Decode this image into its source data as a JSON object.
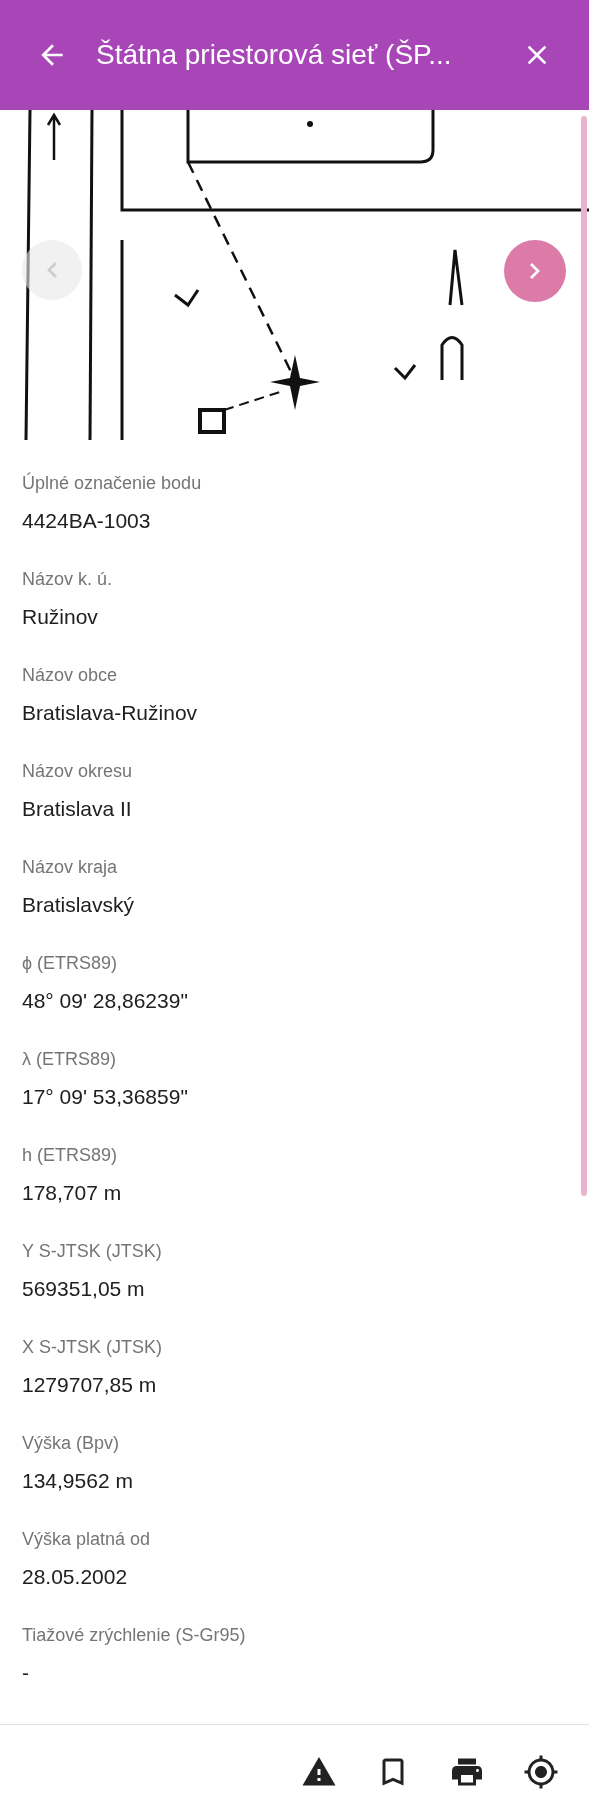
{
  "header": {
    "title": "Štátna priestorová sieť (ŠP..."
  },
  "gallery": {
    "prev_disabled": true
  },
  "fields": [
    {
      "label": "Úplné označenie bodu",
      "value": "4424BA-1003"
    },
    {
      "label": "Názov k. ú.",
      "value": "Ružinov"
    },
    {
      "label": "Názov obce",
      "value": "Bratislava-Ružinov"
    },
    {
      "label": "Názov okresu",
      "value": "Bratislava II"
    },
    {
      "label": "Názov kraja",
      "value": "Bratislavský"
    },
    {
      "label": "ϕ (ETRS89)",
      "value": "48° 09' 28,86239\""
    },
    {
      "label": "λ (ETRS89)",
      "value": "17° 09' 53,36859\""
    },
    {
      "label": "h (ETRS89)",
      "value": "178,707 m"
    },
    {
      "label": "Y S-JTSK (JTSK)",
      "value": "569351,05 m"
    },
    {
      "label": "X S-JTSK (JTSK)",
      "value": "1279707,85 m"
    },
    {
      "label": "Výška (Bpv)",
      "value": "134,9562 m"
    },
    {
      "label": "Výška platná od",
      "value": "28.05.2002"
    },
    {
      "label": "Tiažové zrýchlenie (S-Gr95)",
      "value": "-"
    }
  ],
  "toolbar": [
    {
      "kind": "warning"
    },
    {
      "kind": "bookmark"
    },
    {
      "kind": "print"
    },
    {
      "kind": "locate"
    }
  ]
}
